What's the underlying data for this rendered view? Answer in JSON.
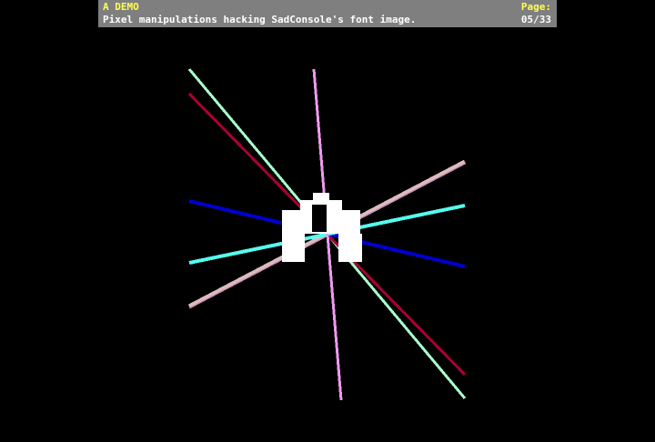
{
  "header": {
    "title": "A DEMO",
    "subtitle": "Pixel manipulations hacking SadConsole's font image.",
    "page_label": "Page:",
    "page_number": "05/33"
  },
  "scene": {
    "glyph": "A",
    "line_colors": {
      "dark_red": "#aa0033",
      "pale_green": "#aaffcc",
      "blue": "#0000cc",
      "cyan": "#55ffee",
      "tan_pink": "#ddbbbb",
      "pink_violet": "#ee99ee"
    },
    "glyph_color": "#ffffff",
    "background": "#000000",
    "header_bg": "#7f7f7f"
  }
}
